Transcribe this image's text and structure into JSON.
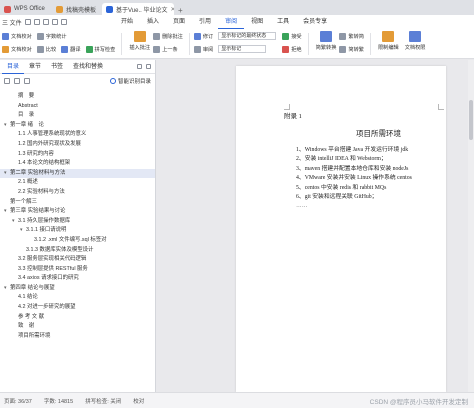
{
  "tabs": [
    {
      "label": "WPS Office",
      "color": "#d9534f",
      "active": false
    },
    {
      "label": "找稿壳模板",
      "color": "#e39b37",
      "active": false
    },
    {
      "label": "基于Vue.. 毕业论文",
      "color": "#2b64d8",
      "active": true
    }
  ],
  "menubar": {
    "file_label": "三 文件",
    "items": [
      "开始",
      "插入",
      "页面",
      "引用",
      "审阅",
      "视图",
      "工具",
      "会员专享"
    ],
    "active_item": "审阅"
  },
  "ribbon": {
    "group1": {
      "row1": [
        "文档校对",
        "字数统计"
      ],
      "row2": [
        "文档校对",
        "比较",
        "翻译",
        "拼写检查"
      ]
    },
    "group2": {
      "big": "插入批注",
      "row1": [
        "删除批注"
      ],
      "row2": [
        "上一条"
      ]
    },
    "group3": {
      "row1": [
        "修订"
      ],
      "select": "显示标记的最终状态",
      "select2": "显示标记",
      "row2": [
        "审阅"
      ]
    },
    "group4": {
      "row1": [
        "接受"
      ],
      "row2": [
        "拒绝"
      ]
    },
    "group5": {
      "big": "简繁转换",
      "row1": [
        "繁转简"
      ],
      "row2": [
        "简转繁"
      ]
    },
    "group6": {
      "big": "限制编辑"
    },
    "group7": {
      "big": "文档权限"
    }
  },
  "nav": {
    "tabs": [
      "目录",
      "章节",
      "书签",
      "查找和替换"
    ],
    "active_tab": "目录",
    "smart_toc_label": "智能识别目录",
    "items": [
      {
        "text": "摘　要",
        "indent": 1,
        "arrow": "",
        "selected": false
      },
      {
        "text": "Abstract",
        "indent": 1,
        "arrow": "",
        "selected": false
      },
      {
        "text": "目　录",
        "indent": 1,
        "arrow": "",
        "selected": false
      },
      {
        "text": "第一章 绪　论",
        "indent": 0,
        "arrow": "▾",
        "selected": false
      },
      {
        "text": "1.1 人事管理系统现状的意义",
        "indent": 1,
        "arrow": "",
        "selected": false
      },
      {
        "text": "1.2 国内外研究现状及发展",
        "indent": 1,
        "arrow": "",
        "selected": false
      },
      {
        "text": "1.3 研究的内容",
        "indent": 1,
        "arrow": "",
        "selected": false
      },
      {
        "text": "1.4 本论文的结构框架",
        "indent": 1,
        "arrow": "",
        "selected": false
      },
      {
        "text": "第二章 实验材料与方法",
        "indent": 0,
        "arrow": "▾",
        "selected": true
      },
      {
        "text": "2.1 概述",
        "indent": 1,
        "arrow": "",
        "selected": false
      },
      {
        "text": "2.2 实验材料与方法",
        "indent": 1,
        "arrow": "",
        "selected": false
      },
      {
        "text": "第一个解三",
        "indent": 0,
        "arrow": "",
        "selected": false
      },
      {
        "text": "第三章 实验结果与讨论",
        "indent": 0,
        "arrow": "▾",
        "selected": false
      },
      {
        "text": "3.1 持久层操作数据库",
        "indent": 1,
        "arrow": "▾",
        "selected": false
      },
      {
        "text": "3.1.1 接口请说明",
        "indent": 2,
        "arrow": "▾",
        "selected": false
      },
      {
        "text": "3.1.2 .xml 文件编写.sql 标签对",
        "indent": 3,
        "arrow": "",
        "selected": false
      },
      {
        "text": "3.1.3 数据库实体及模型设计",
        "indent": 2,
        "arrow": "",
        "selected": false
      },
      {
        "text": "3.2 服务层实现相关代码逻辑",
        "indent": 1,
        "arrow": "",
        "selected": false
      },
      {
        "text": "3.3 控制层提供 RESTful 服务",
        "indent": 1,
        "arrow": "",
        "selected": false
      },
      {
        "text": "3.4 axios 请求接口的研究",
        "indent": 1,
        "arrow": "",
        "selected": false
      },
      {
        "text": "第四章 结论与展望",
        "indent": 0,
        "arrow": "▾",
        "selected": false
      },
      {
        "text": "4.1 结论",
        "indent": 1,
        "arrow": "",
        "selected": false
      },
      {
        "text": "4.2 对进一步研究的展望",
        "indent": 1,
        "arrow": "",
        "selected": false
      },
      {
        "text": "参 考 文 献",
        "indent": 1,
        "arrow": "",
        "selected": false
      },
      {
        "text": "致　谢",
        "indent": 1,
        "arrow": "",
        "selected": false
      },
      {
        "text": "项目所需环境",
        "indent": 1,
        "arrow": "",
        "selected": false
      }
    ]
  },
  "document": {
    "appendix_label": "附录 1",
    "title": "项目所需环境",
    "list": [
      "1、Windows 平台搭建 Java 开发运行环境 jdk",
      "2、安装 intelliJ IDEA 和 Webstorm；",
      "3、maven 搭建并配置本地仓库和安装 nodeJs",
      "4、VMware 安装并安装 Linux 操作系统 centos",
      "5、centos 中安装 redis 和 rabbit MQs",
      "6、git 安装和远程关联 GitHub；"
    ],
    "trailing": "……"
  },
  "status": {
    "page": "页面: 36/37",
    "words": "字数: 14815",
    "spellcheck": "拼写检查: 关闭",
    "proofread": "校对",
    "watermark": "CSDN @程序员小马软件开发定制"
  }
}
